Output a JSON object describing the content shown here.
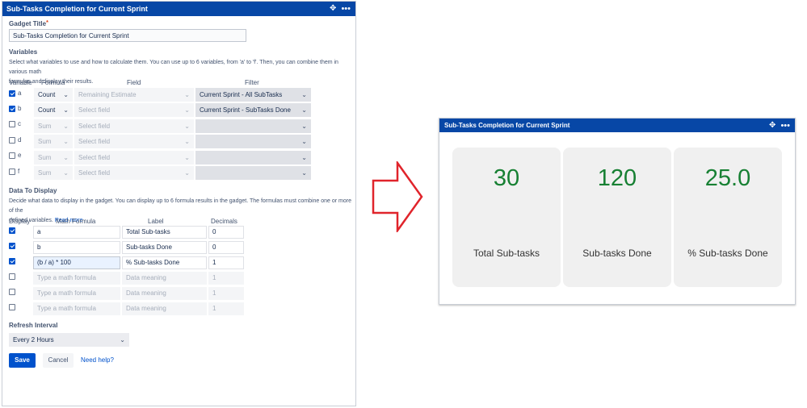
{
  "config_gadget": {
    "header_title": "Sub-Tasks Completion for Current Sprint",
    "gadget_title_label": "Gadget Title",
    "required_mark": "*",
    "gadget_title_value": "Sub-Tasks Completion for Current Sprint",
    "variables_heading": "Variables",
    "variables_help_line1": "Select what variables to use and how to calculate them. You can use up to 6 variables, from 'a' to 'f'. Then, you can combine them in various math",
    "variables_help_line2": "formulas and display their results.",
    "variable_columns": {
      "variable": "Variable",
      "formula": "Formula",
      "field": "Field",
      "filter": "Filter"
    },
    "variables": [
      {
        "letter": "a",
        "checked": true,
        "formula": "Count",
        "field": "Remaining Estimate",
        "filter": "Current Sprint - All SubTasks"
      },
      {
        "letter": "b",
        "checked": true,
        "formula": "Count",
        "field": "Select field",
        "filter": "Current Sprint - SubTasks Done"
      },
      {
        "letter": "c",
        "checked": false,
        "formula": "Sum",
        "field": "Select field",
        "filter": ""
      },
      {
        "letter": "d",
        "checked": false,
        "formula": "Sum",
        "field": "Select field",
        "filter": ""
      },
      {
        "letter": "e",
        "checked": false,
        "formula": "Sum",
        "field": "Select field",
        "filter": ""
      },
      {
        "letter": "f",
        "checked": false,
        "formula": "Sum",
        "field": "Select field",
        "filter": ""
      }
    ],
    "display_heading": "Data To Display",
    "display_help_line1": "Decide what data to display in the gadget. You can display up to 6 formula results in the gadget. The formulas must combine one or more of the",
    "display_help_line2": "defined variables.",
    "read_more": "Read more",
    "display_columns": {
      "display": "Display",
      "math_formula": "Math Formula",
      "label": "Label",
      "decimals": "Decimals"
    },
    "display_rows": [
      {
        "checked": true,
        "formula": "a",
        "label": "Total Sub-tasks",
        "decimals": "0"
      },
      {
        "checked": true,
        "formula": "b",
        "label": "Sub-tasks Done",
        "decimals": "0"
      },
      {
        "checked": true,
        "formula": "(b / a) * 100",
        "label": "% Sub-tasks Done",
        "decimals": "1"
      },
      {
        "checked": false,
        "formula": "Type a math formula",
        "label": "Data meaning",
        "decimals": "1"
      },
      {
        "checked": false,
        "formula": "Type a math formula",
        "label": "Data meaning",
        "decimals": "1"
      },
      {
        "checked": false,
        "formula": "Type a math formula",
        "label": "Data meaning",
        "decimals": "1"
      }
    ],
    "refresh_heading": "Refresh Interval",
    "refresh_value": "Every 2 Hours",
    "save_label": "Save",
    "cancel_label": "Cancel",
    "help_label": "Need help?"
  },
  "result_gadget": {
    "header_title": "Sub-Tasks Completion for Current Sprint",
    "cards": [
      {
        "value": "30",
        "caption": "Total Sub-tasks"
      },
      {
        "value": "120",
        "caption": "Sub-tasks Done"
      },
      {
        "value": "25.0",
        "caption": "% Sub-tasks Done"
      }
    ]
  },
  "icons": {
    "header_move": "move-icon",
    "header_menu": "more-icon",
    "chevron": "chevron-down-icon",
    "arrow": "arrow-right-icon"
  },
  "colors": {
    "header_blue": "#0747a6",
    "primary_button": "#0052cc",
    "value_green": "#178033",
    "arrow_red": "#e0242b"
  }
}
